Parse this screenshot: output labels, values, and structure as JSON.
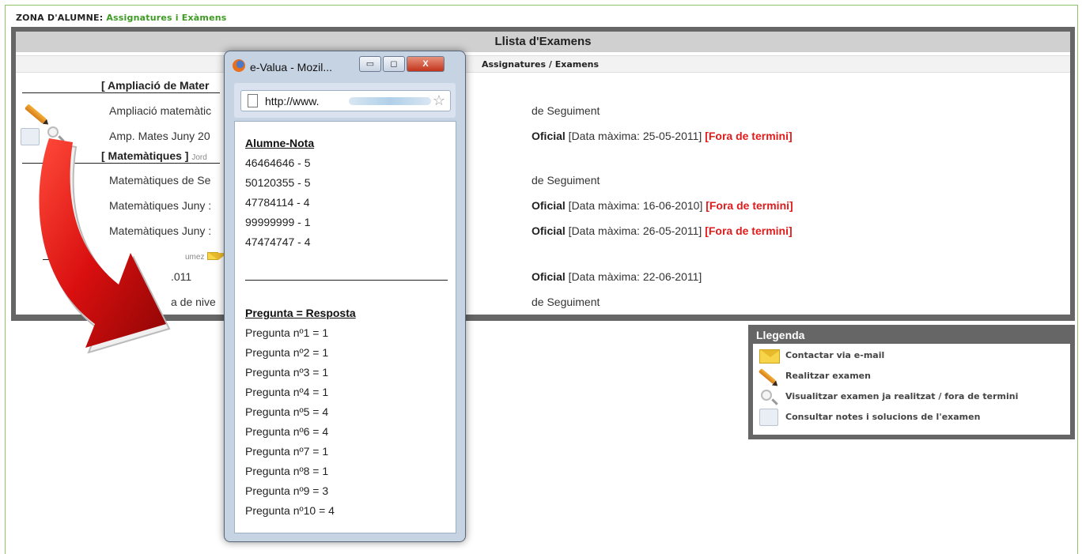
{
  "header": {
    "zone_label": "ZONA D'ALUMNE:",
    "zone_section": "Assignatures i Exàmens"
  },
  "panel": {
    "title": "Llista d'Examens",
    "column_header": "Assignatures / Examens",
    "subjects": [
      {
        "name": "[ Ampliació de Mater",
        "teacher": ""
      },
      {
        "name": "[ Matemàtiques ]",
        "teacher": "Jord"
      },
      {
        "name": "",
        "teacher": "umez"
      }
    ],
    "exams": [
      {
        "name": "Ampliació matemàtic",
        "type_bold": "",
        "type_text": "de Seguiment",
        "late": ""
      },
      {
        "name": "Amp. Mates Juny 20",
        "type_bold": "Oficial",
        "type_text": " [Data màxima: 25-05-2011]",
        "late": "[Fora de termini]"
      },
      {
        "name": "Matemàtiques de Se",
        "type_bold": "",
        "type_text": "de Seguiment",
        "late": ""
      },
      {
        "name": "Matemàtiques Juny :",
        "type_bold": "Oficial",
        "type_text": " [Data màxima: 16-06-2010]",
        "late": "[Fora de termini]"
      },
      {
        "name": "Matemàtiques Juny :",
        "type_bold": "Oficial",
        "type_text": " [Data màxima: 26-05-2011]",
        "late": "[Fora de termini]"
      },
      {
        "name": ".011",
        "type_bold": "Oficial",
        "type_text": " [Data màxima: 22-06-2011]",
        "late": ""
      },
      {
        "name": "a de nive",
        "type_bold": "",
        "type_text": "de Seguiment",
        "late": ""
      }
    ]
  },
  "legend": {
    "title": "Llegenda",
    "items": [
      {
        "icon": "mail-icon",
        "label": "Contactar via e-mail"
      },
      {
        "icon": "pencil-icon",
        "label": "Realitzar examen"
      },
      {
        "icon": "magnifier-icon",
        "label": "Visualitzar examen ja realitzat / fora de termini"
      },
      {
        "icon": "document-icon",
        "label": "Consultar notes i solucions de l'examen"
      }
    ]
  },
  "popup": {
    "title": "e-Valua - Mozil...",
    "url": "http://www.",
    "buttons": {
      "minimize": "▭",
      "maximize": "◻",
      "close": "X"
    },
    "grades_heading": "Alumne-Nota",
    "grades": [
      "46464646 - 5",
      "50120355 - 5",
      "47784114 - 4",
      "99999999 - 1",
      "47474747 - 4"
    ],
    "answers_heading": "Pregunta = Resposta",
    "answers": [
      "Pregunta nº1 = 1",
      "Pregunta nº2 = 1",
      "Pregunta nº3 = 1",
      "Pregunta nº4 = 1",
      "Pregunta nº5 = 4",
      "Pregunta nº6 = 4",
      "Pregunta nº7 = 1",
      "Pregunta nº8 = 1",
      "Pregunta nº9 = 3",
      "Pregunta nº10 = 4"
    ]
  },
  "colors": {
    "accent_green": "#3d9a23",
    "late_red": "#e01b1b",
    "panel_gray": "#666666",
    "arrow_red": "#d90f0f"
  }
}
